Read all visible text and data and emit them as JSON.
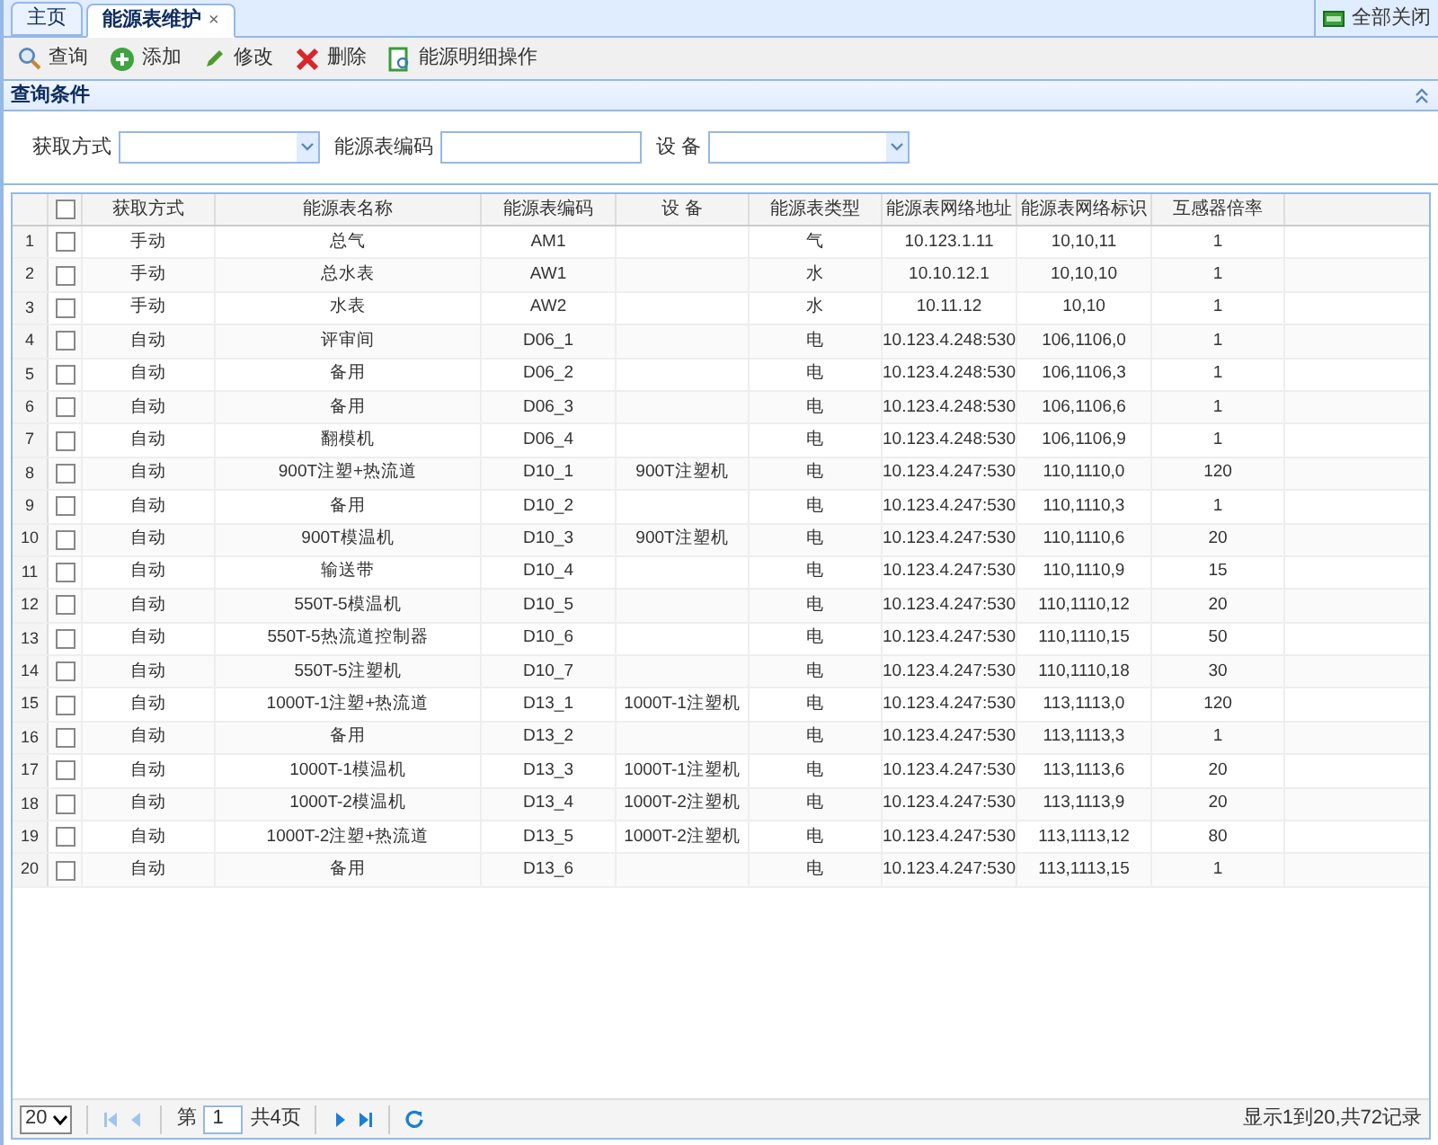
{
  "tabs": [
    {
      "label": "主页",
      "selected": false,
      "closable": false
    },
    {
      "label": "能源表维护",
      "selected": true,
      "closable": true,
      "close": "×"
    }
  ],
  "close_all": "全部关闭",
  "toolbar": [
    {
      "label": "查询",
      "kind": "search"
    },
    {
      "label": "添加",
      "kind": "add"
    },
    {
      "label": "修改",
      "kind": "edit"
    },
    {
      "label": "删除",
      "kind": "delete"
    },
    {
      "label": "能源明细操作",
      "kind": "detail"
    }
  ],
  "query_panel": {
    "title": "查询条件",
    "expanded": true
  },
  "filters": [
    {
      "label": "获取方式",
      "kind": "select"
    },
    {
      "label": "能源表编码",
      "kind": "text"
    },
    {
      "label": "设 备",
      "kind": "select"
    }
  ],
  "table": {
    "all_checked": false,
    "columns": [
      "获取方式",
      "能源表名称",
      "能源表编码",
      "设 备",
      "能源表类型",
      "能源表网络地址",
      "能源表网络标识",
      "互感器倍率"
    ],
    "rows": [
      {
        "num": "1",
        "checked": false,
        "cells": [
          "手动",
          "总气",
          "AM1",
          "",
          "气",
          "10.123.1.11",
          "10,10,11",
          "1"
        ]
      },
      {
        "num": "2",
        "checked": false,
        "cells": [
          "手动",
          "总水表",
          "AW1",
          "",
          "水",
          "10.10.12.1",
          "10,10,10",
          "1"
        ]
      },
      {
        "num": "3",
        "checked": false,
        "cells": [
          "手动",
          "水表",
          "AW2",
          "",
          "水",
          "10.11.12",
          "10,10",
          "1"
        ]
      },
      {
        "num": "4",
        "checked": false,
        "cells": [
          "自动",
          "评审间",
          "D06_1",
          "",
          "电",
          "10.123.4.248:530",
          "106,1106,0",
          "1"
        ]
      },
      {
        "num": "5",
        "checked": false,
        "cells": [
          "自动",
          "备用",
          "D06_2",
          "",
          "电",
          "10.123.4.248:530",
          "106,1106,3",
          "1"
        ]
      },
      {
        "num": "6",
        "checked": false,
        "cells": [
          "自动",
          "备用",
          "D06_3",
          "",
          "电",
          "10.123.4.248:530",
          "106,1106,6",
          "1"
        ]
      },
      {
        "num": "7",
        "checked": false,
        "cells": [
          "自动",
          "翻模机",
          "D06_4",
          "",
          "电",
          "10.123.4.248:530",
          "106,1106,9",
          "1"
        ]
      },
      {
        "num": "8",
        "checked": false,
        "cells": [
          "自动",
          "900T注塑+热流道",
          "D10_1",
          "900T注塑机",
          "电",
          "10.123.4.247:530",
          "110,1110,0",
          "120"
        ]
      },
      {
        "num": "9",
        "checked": false,
        "cells": [
          "自动",
          "备用",
          "D10_2",
          "",
          "电",
          "10.123.4.247:530",
          "110,1110,3",
          "1"
        ]
      },
      {
        "num": "10",
        "checked": false,
        "cells": [
          "自动",
          "900T模温机",
          "D10_3",
          "900T注塑机",
          "电",
          "10.123.4.247:530",
          "110,1110,6",
          "20"
        ]
      },
      {
        "num": "11",
        "checked": false,
        "cells": [
          "自动",
          "输送带",
          "D10_4",
          "",
          "电",
          "10.123.4.247:530",
          "110,1110,9",
          "15"
        ]
      },
      {
        "num": "12",
        "checked": false,
        "cells": [
          "自动",
          "550T-5模温机",
          "D10_5",
          "",
          "电",
          "10.123.4.247:530",
          "110,1110,12",
          "20"
        ]
      },
      {
        "num": "13",
        "checked": false,
        "cells": [
          "自动",
          "550T-5热流道控制器",
          "D10_6",
          "",
          "电",
          "10.123.4.247:530",
          "110,1110,15",
          "50"
        ]
      },
      {
        "num": "14",
        "checked": false,
        "cells": [
          "自动",
          "550T-5注塑机",
          "D10_7",
          "",
          "电",
          "10.123.4.247:530",
          "110,1110,18",
          "30"
        ]
      },
      {
        "num": "15",
        "checked": false,
        "cells": [
          "自动",
          "1000T-1注塑+热流道",
          "D13_1",
          "1000T-1注塑机",
          "电",
          "10.123.4.247:530",
          "113,1113,0",
          "120"
        ]
      },
      {
        "num": "16",
        "checked": false,
        "cells": [
          "自动",
          "备用",
          "D13_2",
          "",
          "电",
          "10.123.4.247:530",
          "113,1113,3",
          "1"
        ]
      },
      {
        "num": "17",
        "checked": false,
        "cells": [
          "自动",
          "1000T-1模温机",
          "D13_3",
          "1000T-1注塑机",
          "电",
          "10.123.4.247:530",
          "113,1113,6",
          "20"
        ]
      },
      {
        "num": "18",
        "checked": false,
        "cells": [
          "自动",
          "1000T-2模温机",
          "D13_4",
          "1000T-2注塑机",
          "电",
          "10.123.4.247:530",
          "113,1113,9",
          "20"
        ]
      },
      {
        "num": "19",
        "checked": false,
        "cells": [
          "自动",
          "1000T-2注塑+热流道",
          "D13_5",
          "1000T-2注塑机",
          "电",
          "10.123.4.247:530",
          "113,1113,12",
          "80"
        ]
      },
      {
        "num": "20",
        "checked": false,
        "cells": [
          "自动",
          "备用",
          "D13_6",
          "",
          "电",
          "10.123.4.247:530",
          "113,1113,15",
          "1"
        ]
      }
    ]
  },
  "pager": {
    "page_size": "20",
    "page_prefix": "第",
    "page": "1",
    "page_total": "共4页",
    "summary": "显示1到20,共72记录"
  }
}
